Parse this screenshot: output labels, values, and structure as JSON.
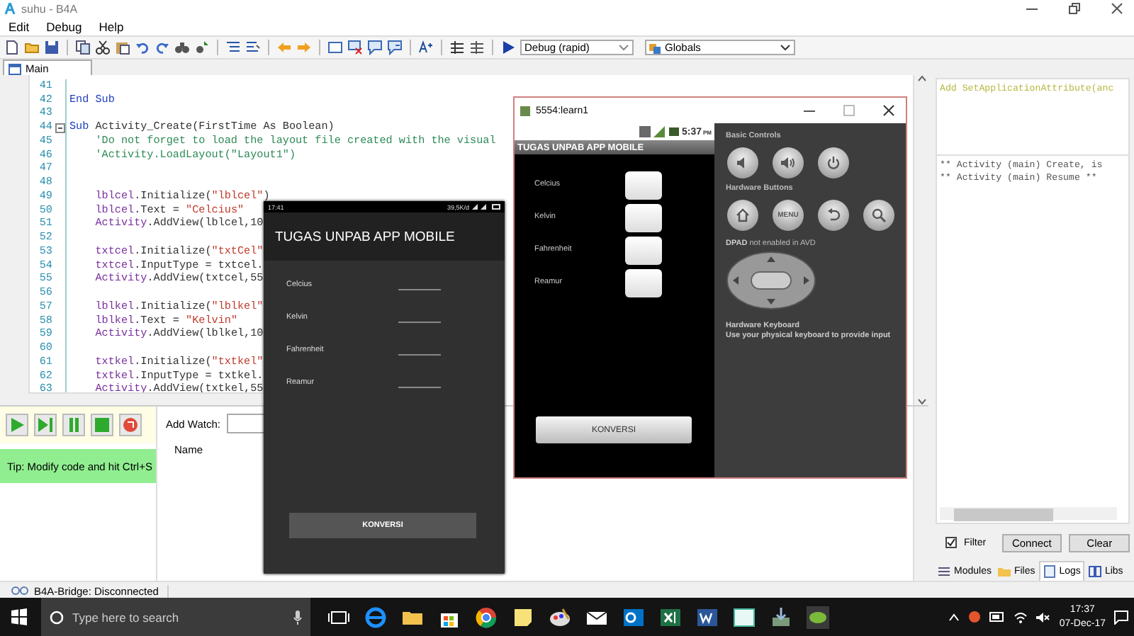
{
  "window": {
    "title": "suhu - B4A"
  },
  "menu": [
    "Edit",
    "Debug",
    "Help"
  ],
  "toolbar": {
    "build_mode": "Debug (rapid)",
    "module": "Globals"
  },
  "editor_tabs": [
    {
      "label": "Main",
      "selected": true
    }
  ],
  "code": [
    {
      "number": "41",
      "kind": "blank",
      "fold": false
    },
    {
      "number": "42",
      "kind": "end",
      "text": "End Sub",
      "fold": false
    },
    {
      "number": "43",
      "kind": "blank",
      "fold": false
    },
    {
      "number": "44",
      "kind": "declaration",
      "text": "Sub Activity_Create(FirstTime As Boolean)",
      "fold": true
    },
    {
      "number": "45",
      "kind": "comment",
      "text": "    'Do not forget to load the layout file created with the visual",
      "fold": false
    },
    {
      "number": "46",
      "kind": "comment",
      "text": "    'Activity.LoadLayout(\"Layout1\")",
      "fold": false
    },
    {
      "number": "47",
      "kind": "blank",
      "fold": false
    },
    {
      "number": "48",
      "kind": "blank",
      "fold": false
    },
    {
      "number": "49",
      "kind": "statement",
      "text": "    lblcel.Initialize(\"lblcel\")",
      "fold": false
    },
    {
      "number": "50",
      "kind": "statement",
      "text": "    lblcel.Text = \"Celcius\"",
      "fold": false
    },
    {
      "number": "51",
      "kind": "statement",
      "text": "    Activity.AddView(lblcel,10",
      "fold": false
    },
    {
      "number": "52",
      "kind": "blank",
      "fold": false
    },
    {
      "number": "53",
      "kind": "statement",
      "text": "    txtcel.Initialize(\"txtCel\"",
      "fold": false
    },
    {
      "number": "54",
      "kind": "statement",
      "text": "    txtcel.InputType = txtcel.",
      "fold": false
    },
    {
      "number": "55",
      "kind": "statement",
      "text": "    Activity.AddView(txtcel,55",
      "fold": false
    },
    {
      "number": "56",
      "kind": "blank",
      "fold": false
    },
    {
      "number": "57",
      "kind": "statement",
      "text": "    lblkel.Initialize(\"lblkel\"",
      "fold": false
    },
    {
      "number": "58",
      "kind": "statement",
      "text": "    lblkel.Text = \"Kelvin\"",
      "fold": false
    },
    {
      "number": "59",
      "kind": "statement",
      "text": "    Activity.AddView(lblkel,10",
      "fold": false
    },
    {
      "number": "60",
      "kind": "blank",
      "fold": false
    },
    {
      "number": "61",
      "kind": "statement",
      "text": "    txtkel.Initialize(\"txtkel\"",
      "fold": false
    },
    {
      "number": "62",
      "kind": "statement",
      "text": "    txtkel.InputType = txtkel.",
      "fold": false
    },
    {
      "number": "63",
      "kind": "statement",
      "text": "    Activity.AddView(txtkel,55",
      "fold": false
    }
  ],
  "debug": {
    "tip": "Tip: Modify code and hit Ctrl+S",
    "watch_label": "Add Watch:",
    "watch_column": "Name"
  },
  "status_bar": "B4A-Bridge: Disconnected",
  "right_panel": {
    "manifest_line": "Add SetApplicationAttribute(anc",
    "logs": [
      "** Activity (main) Create, is",
      "** Activity (main) Resume **"
    ],
    "filter": {
      "label": "Filter",
      "checked": true
    },
    "buttons": [
      "Connect",
      "Clear"
    ],
    "tabs": [
      {
        "label": "Modules",
        "selected": false
      },
      {
        "label": "Files",
        "selected": false
      },
      {
        "label": "Logs",
        "selected": true
      },
      {
        "label": "Libs",
        "selected": false
      }
    ]
  },
  "phone_screenshot": {
    "status_time": "17:41",
    "status_info": "39,5K/d",
    "app_title": "TUGAS UNPAB APP MOBILE",
    "fields": [
      "Celcius",
      "Kelvin",
      "Fahrenheit",
      "Reamur"
    ],
    "button": "KONVERSI"
  },
  "emulator": {
    "title": "5554:learn1",
    "clock": "5:37",
    "clock_suffix": "PM",
    "app_title": "TUGAS UNPAB APP MOBILE",
    "fields": [
      "Celcius",
      "Kelvin",
      "Fahrenheit",
      "Reamur"
    ],
    "button": "KONVERSI",
    "basic_controls": "Basic Controls",
    "hardware_buttons": "Hardware Buttons",
    "menu_key": "MENU",
    "dpad_note": "**DPAD** not enabled in AVD",
    "keyboard_title": "Hardware Keyboard",
    "keyboard_note": "Use your physical keyboard to provide input"
  },
  "taskbar": {
    "search_placeholder": "Type here to search",
    "time": "17:37",
    "date": "07-Dec-17"
  }
}
